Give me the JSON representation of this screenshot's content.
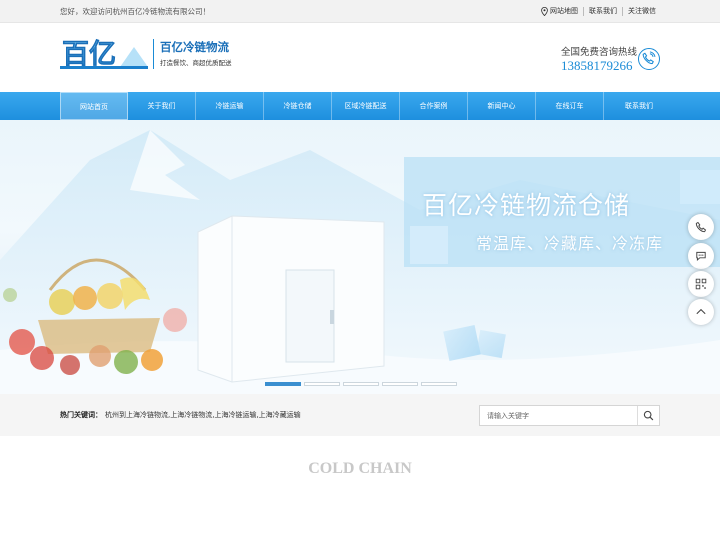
{
  "topbar": {
    "welcome": "您好，欢迎访问杭州百亿冷链物流有限公司！",
    "links": [
      "网站地图",
      "联系我们",
      "关注微信"
    ]
  },
  "header": {
    "logo_text": "百亿",
    "brand_name": "百亿冷链物流",
    "slogan": "打造餐饮、商超优质配送",
    "hotline_label": "全国免费咨询热线",
    "hotline_number": "13858179266"
  },
  "nav": {
    "items": [
      "网站首页",
      "关于我们",
      "冷链运输",
      "冷链仓储",
      "区域冷链配送",
      "合作案例",
      "新闻中心",
      "在线订车",
      "联系我们"
    ],
    "active_index": 0
  },
  "banner": {
    "title": "百亿冷链物流仓储",
    "subtitle": "常温库、冷藏库、冷冻库",
    "slides_count": 5,
    "active_slide": 0
  },
  "sidebar": {
    "icons": [
      "phone-icon",
      "chat-icon",
      "qrcode-icon",
      "back-to-top-icon"
    ]
  },
  "search": {
    "hot_label": "热门关键词：",
    "hot_words": "杭州到上海冷链物流,上海冷链物流,上海冷链运输,上海冷藏运输",
    "placeholder": "请输入关键字"
  },
  "section": {
    "title": "COLD CHAIN"
  },
  "colors": {
    "brand_blue": "#1a8bd6",
    "nav_blue": "#2a9ae6",
    "active_dot": "#3a8fd0"
  }
}
